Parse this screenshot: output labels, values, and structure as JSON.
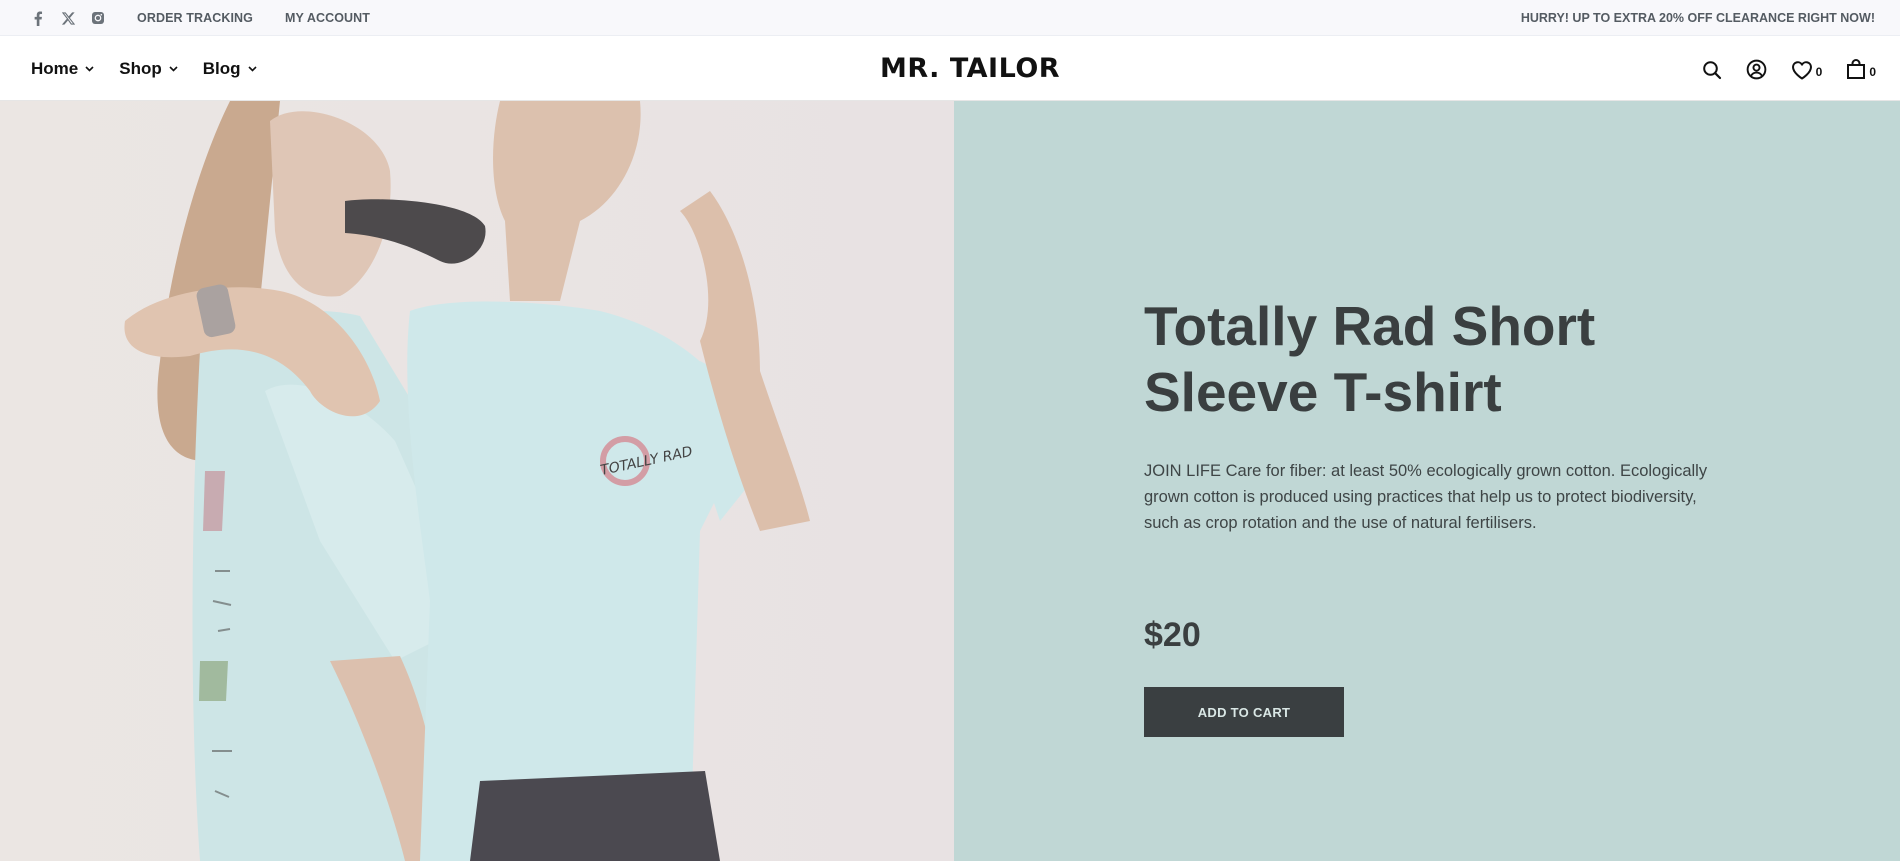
{
  "topbar": {
    "social": [
      "facebook-icon",
      "x-twitter-icon",
      "instagram-icon"
    ],
    "links": [
      "ORDER TRACKING",
      "MY ACCOUNT"
    ],
    "promo": "HURRY! UP TO EXTRA 20% OFF CLEARANCE RIGHT NOW!"
  },
  "header": {
    "nav": [
      {
        "label": "Home"
      },
      {
        "label": "Shop"
      },
      {
        "label": "Blog"
      }
    ],
    "logo": "MR. TAILOR",
    "wishlist_count": "0",
    "cart_count": "0"
  },
  "hero": {
    "title": "Totally Rad Short Sleeve T-shirt",
    "description": "JOIN LIFE Care for fiber: at least 50% ecologically grown cotton. Ecologically grown cotton is produced using practices that help us to protect biodiversity, such as crop rotation and the use of natural fertilisers.",
    "price": "$20",
    "button_label": "ADD TO CART",
    "tshirt_print_text": "TOTALLY RAD"
  },
  "colors": {
    "panel_bg": "#c0d7d5",
    "button_bg": "#3a3f41",
    "text_dark": "#3a3f40",
    "shirt": "#cfe8ea"
  }
}
